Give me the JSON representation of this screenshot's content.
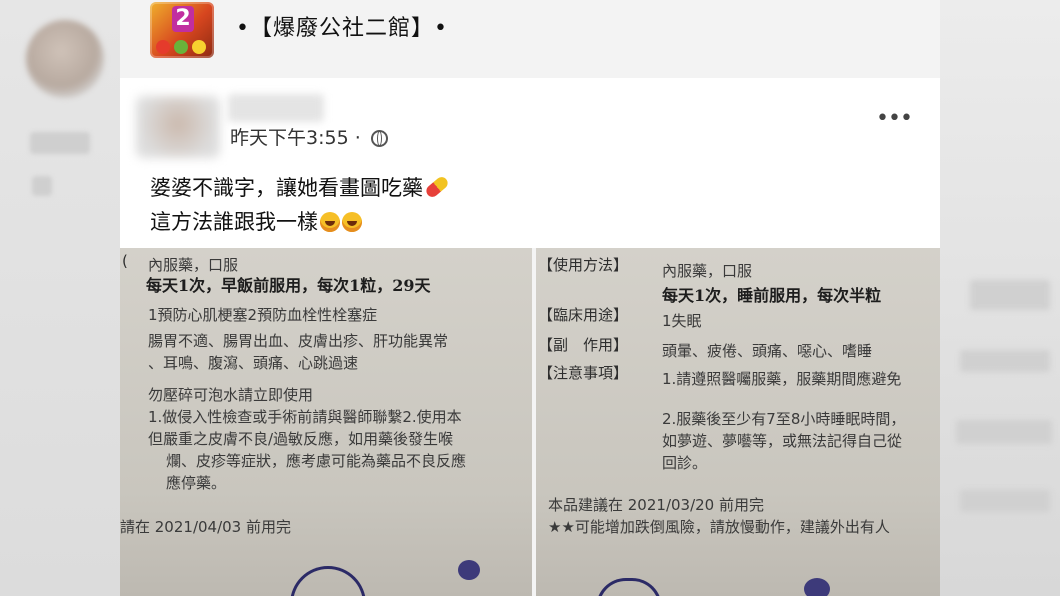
{
  "group": {
    "icon_number": "2",
    "name": "•【爆廢公社二館】•"
  },
  "post": {
    "timestamp": "昨天下午3:55",
    "separator": "·",
    "text_line1": "婆婆不識字，讓她看畫圖吃藥",
    "text_line2": "這方法誰跟我一樣",
    "more_label": "•••"
  },
  "photo_left": {
    "lines": [
      "內服藥，口服",
      "每天1次，早飯前服用，每次1粒，29天",
      "1預防心肌梗塞2預防血栓性栓塞症",
      "腸胃不適、腸胃出血、皮膚出疹、肝功能異常",
      "、耳鳴、腹瀉、頭痛、心跳過速",
      "勿壓碎可泡水請立即使用",
      "1.做侵入性檢查或手術前請與醫師聯繫2.使用本",
      "但嚴重之皮膚不良/過敏反應，如用藥後發生喉",
      "爛、皮疹等症狀，應考慮可能為藥品不良反應",
      "應停藥。",
      "請在 2021/04/03 前用完"
    ]
  },
  "photo_right": {
    "labels": [
      "【使用方法】",
      "【臨床用途】",
      "【副　作用】",
      "【注意事項】"
    ],
    "lines": [
      "內服藥，口服",
      "每天1次，睡前服用，每次半粒",
      "1失眠",
      "頭暈、疲倦、頭痛、噁心、嗜睡",
      "1.請遵照醫囑服藥，服藥期間應避免",
      "2.服藥後至少有7至8小時睡眠時間，",
      "如夢遊、夢囈等，或無法記得自己從",
      "回診。",
      "本品建議在 2021/03/20 前用完",
      "★★可能增加跌倒風險，請放慢動作，建議外出有人"
    ]
  }
}
